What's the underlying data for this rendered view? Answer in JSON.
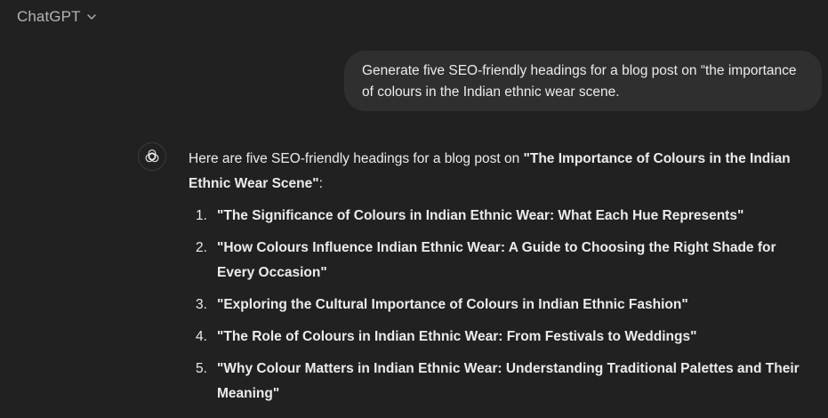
{
  "header": {
    "model_name": "ChatGPT",
    "dropdown_icon": "chevron-down-icon"
  },
  "user_message": {
    "text": "Generate five SEO-friendly headings for a blog post on “the importance of colours in the Indian ethnic wear scene."
  },
  "assistant_message": {
    "avatar_icon": "openai-logo-icon",
    "intro_prefix": "Here are five SEO-friendly headings for a blog post on ",
    "intro_bold": "\"The Importance of Colours in the Indian Ethnic Wear Scene\"",
    "intro_suffix": ":",
    "headings": [
      {
        "number": "1.",
        "text": "\"The Significance of Colours in Indian Ethnic Wear: What Each Hue Represents\""
      },
      {
        "number": "2.",
        "text": "\"How Colours Influence Indian Ethnic Wear: A Guide to Choosing the Right Shade for Every Occasion\""
      },
      {
        "number": "3.",
        "text": "\"Exploring the Cultural Importance of Colours in Indian Ethnic Fashion\""
      },
      {
        "number": "4.",
        "text": "\"The Role of Colours in Indian Ethnic Wear: From Festivals to Weddings\""
      },
      {
        "number": "5.",
        "text": "\"Why Colour Matters in Indian Ethnic Wear: Understanding Traditional Palettes and Their Meaning\""
      }
    ]
  },
  "colors": {
    "background": "#212121",
    "user_bubble": "#2f2f2f",
    "text": "#ececec",
    "muted_text": "#b4b4b4"
  }
}
